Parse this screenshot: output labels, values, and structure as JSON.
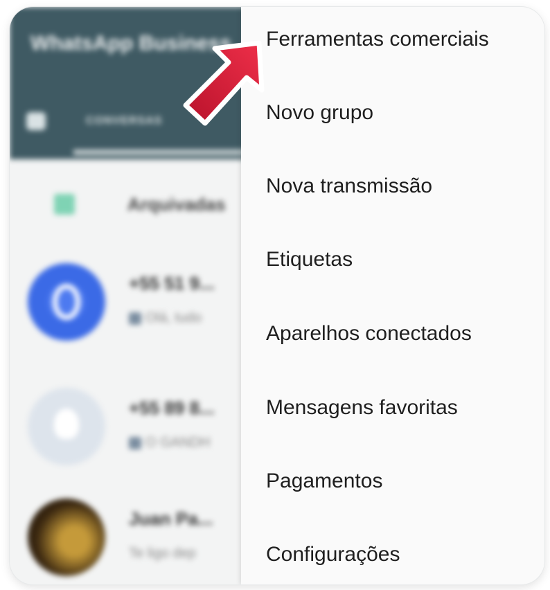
{
  "background_app": {
    "title": "WhatsApp Business",
    "tab": "CONVERSAS",
    "archived_label": "Arquivadas",
    "chats": [
      {
        "name": "+55 51 9...",
        "preview": "Olá, tudo"
      },
      {
        "name": "+55 89 8...",
        "preview": "O GANDH"
      },
      {
        "name": "Juan Pa...",
        "preview": "Te ligo dep"
      }
    ]
  },
  "menu": {
    "items": [
      {
        "label": "Ferramentas comerciais",
        "highlighted": true
      },
      {
        "label": "Novo grupo"
      },
      {
        "label": "Nova transmissão"
      },
      {
        "label": "Etiquetas"
      },
      {
        "label": "Aparelhos conectados"
      },
      {
        "label": "Mensagens favoritas"
      },
      {
        "label": "Pagamentos"
      },
      {
        "label": "Configurações"
      }
    ]
  },
  "colors": {
    "header": "#3f5a63",
    "menu_background": "#fafafa",
    "arrow": "#d8203a",
    "text": "#1f1f1f"
  },
  "icons": {
    "callout": "red-arrow-icon",
    "header": "camera-icon",
    "archive": "archive-icon"
  }
}
